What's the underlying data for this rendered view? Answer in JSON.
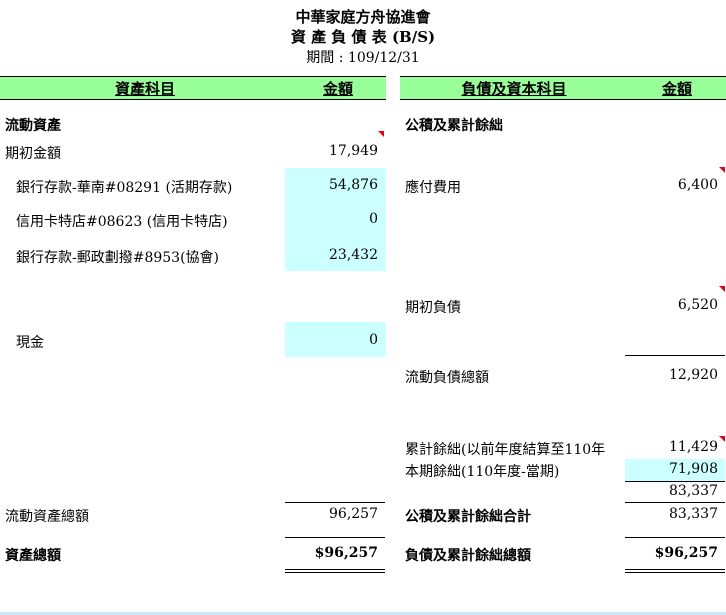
{
  "header": {
    "org": "中華家庭方舟協進會",
    "report_title": "資 產 負 債 表 (B/S)",
    "period": "期間 : 109/12/31"
  },
  "columns": {
    "asset_item": "資產科目",
    "amount_left": "金額",
    "liability_item": "負債及資本科目",
    "amount_right": "金額"
  },
  "assets": {
    "section": "流動資產",
    "opening_label": "期初金額",
    "opening_value": "17,949",
    "bank_huanan_label": "銀行存款-華南#08291 (活期存款)",
    "bank_huanan_value": "54,876",
    "credit_card_label": "信用卡特店#08623 (信用卡特店)",
    "credit_card_value": "0",
    "bank_post_label": "銀行存款-郵政劃撥#8953(協會)",
    "bank_post_value": "23,432",
    "cash_label": "現金",
    "cash_value": "0",
    "current_total_label": "流動資產總額",
    "current_total_value": "96,257",
    "total_label": "資產總額",
    "total_value": "$96,257"
  },
  "liabilities": {
    "section": "公積及累計餘絀",
    "payable_label": "應付費用",
    "payable_value": "6,400",
    "opening_label": "期初負債",
    "opening_value": "6,520",
    "current_total_label": "流動負債總額",
    "current_total_value": "12,920",
    "accum_label": "累計餘絀(以前年度結算至110年",
    "accum_value": "11,429",
    "period_label": "本期餘絀(110年度-當期)",
    "period_value": "71,908",
    "subtotal_value": "83,337",
    "reserve_total_label": "公積及累計餘絀合計",
    "reserve_total_value": "83,337",
    "grand_total_label": "負債及累計餘絀總額",
    "grand_total_value": "$96,257"
  },
  "colors": {
    "header_bg": "#99ff99",
    "input_cell_bg": "#ccffff",
    "comment_flag": "#e8001c"
  }
}
